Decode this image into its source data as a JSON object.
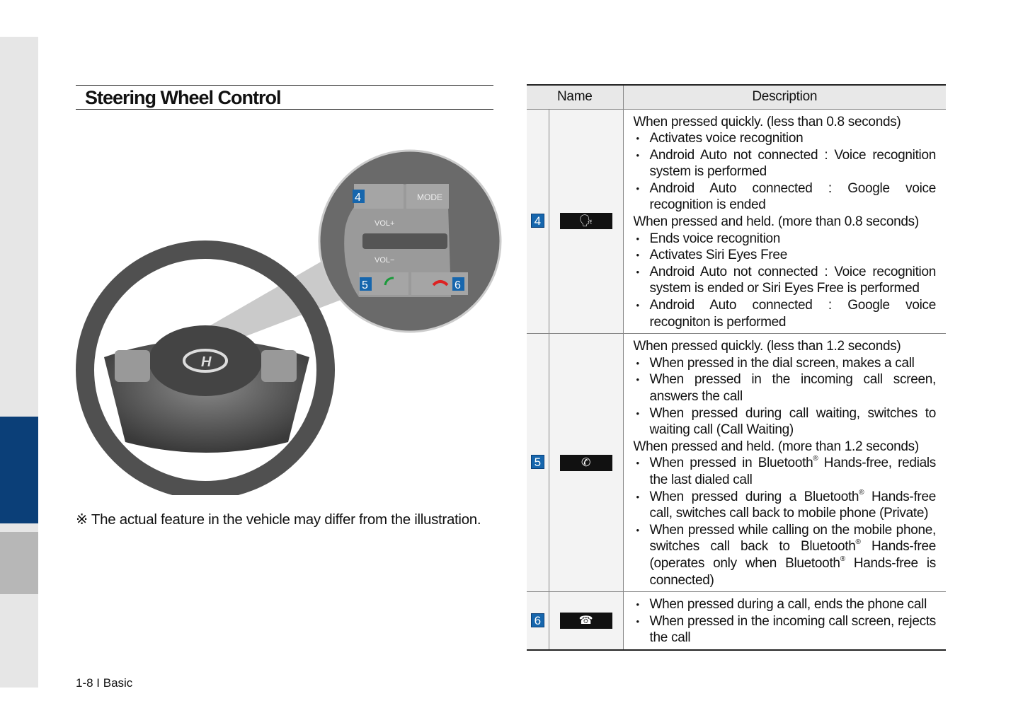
{
  "title": "Steering Wheel Control",
  "note": "※ The actual feature in the vehicle may differ from the illustration.",
  "footer": "1-8 I Basic",
  "illustration": {
    "labels": [
      "4",
      "5",
      "6"
    ],
    "mode": "MODE",
    "vol_up": "VOL+",
    "vol_down": "VOL−"
  },
  "table": {
    "headers": [
      "Name",
      "Description"
    ],
    "rows": [
      {
        "num": "4",
        "icon": "voice-recognition-icon",
        "lines": [
          {
            "t": "h",
            "text": "When pressed quickly. (less than 0.8 seconds)"
          },
          {
            "t": "b",
            "text": "Activates voice recognition"
          },
          {
            "t": "b",
            "text": "Android Auto not connected : Voice recognition system is performed"
          },
          {
            "t": "b",
            "text": "Android Auto connected : Google voice recognition is ended"
          },
          {
            "t": "h",
            "text": "When pressed and held. (more than 0.8 seconds)"
          },
          {
            "t": "b",
            "text": "Ends voice recognition"
          },
          {
            "t": "b",
            "text": "Activates Siri Eyes Free"
          },
          {
            "t": "b",
            "text": "Android Auto not connected : Voice recognition system is ended or Siri Eyes Free is performed"
          },
          {
            "t": "b",
            "text": "Android Auto connected : Google voice recogniton is performed"
          }
        ]
      },
      {
        "num": "5",
        "icon": "call-icon",
        "lines": [
          {
            "t": "h",
            "text": "When pressed quickly. (less than 1.2 seconds)"
          },
          {
            "t": "b",
            "text": "When pressed in the dial screen, makes a call"
          },
          {
            "t": "b",
            "text": "When pressed in the incoming call screen, answers the call"
          },
          {
            "t": "b",
            "text": "When pressed during call waiting, switches to waiting call (Call Waiting)"
          },
          {
            "t": "h",
            "text": "When pressed and held. (more than 1.2 seconds)"
          },
          {
            "t": "b",
            "text": "When pressed in Bluetooth® Hands-free, redials the last dialed call"
          },
          {
            "t": "b",
            "text": "When pressed during a Bluetooth® Hands-free call, switches call back to mobile phone (Private)"
          },
          {
            "t": "b",
            "text": "When pressed while calling on the mobile phone, switches call back to Bluetooth® Hands-free (operates only when Bluetooth® Hands-free is connected)"
          }
        ]
      },
      {
        "num": "6",
        "icon": "end-call-icon",
        "lines": [
          {
            "t": "b",
            "text": "When pressed during a call, ends the phone call"
          },
          {
            "t": "b",
            "text": "When pressed in the incoming call screen, rejects the call"
          }
        ]
      }
    ]
  }
}
